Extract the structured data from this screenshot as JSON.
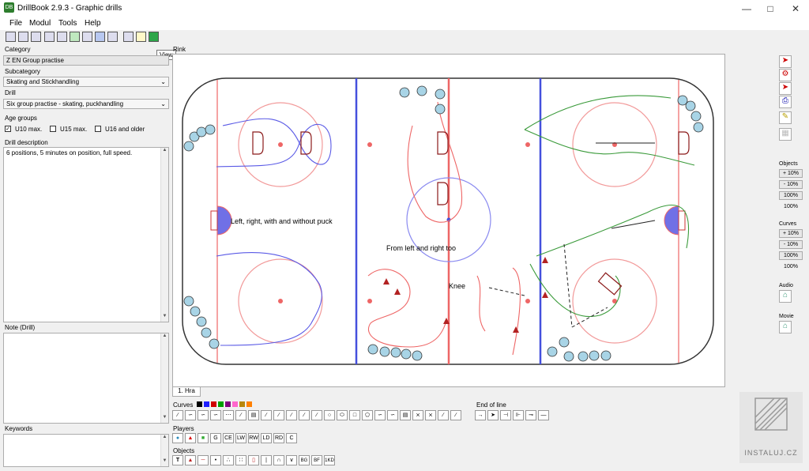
{
  "window": {
    "title": "DrillBook 2.9.3 - Graphic drills",
    "icon": "app-icon",
    "controls": [
      "minimize-icon",
      "maximize-icon",
      "close-icon"
    ]
  },
  "menu": [
    "File",
    "Modul",
    "Tools",
    "Help"
  ],
  "tooltip": "View",
  "left_panel": {
    "category_label": "Category",
    "category_value": "Z EN Group practise",
    "subcategory_label": "Subcategory",
    "subcategory_value": "Skating and Stickhandling",
    "drill_label": "Drill",
    "drill_value": "Six group practise - skating, puckhandling",
    "age_groups_label": "Age groups",
    "age_groups": [
      {
        "label": "U10 max.",
        "checked": true
      },
      {
        "label": "U15 max.",
        "checked": false
      },
      {
        "label": "U16 and older",
        "checked": false
      }
    ],
    "description_label": "Drill description",
    "description_value": "6 positions, 5 minutes on position, full speed.",
    "note_label": "Note (Drill)",
    "note_value": "",
    "keywords_label": "Keywords",
    "keywords_value": ""
  },
  "rink": {
    "label": "Rink",
    "texts": [
      "Left, right, with and without puck",
      "From left and right too",
      "Knee"
    ],
    "tab_label": "1. Hra"
  },
  "bottom": {
    "curves_label": "Curves",
    "end_of_line_label": "End of line",
    "players_label": "Players",
    "players": [
      "G",
      "CE",
      "LW",
      "RW",
      "LD",
      "RD",
      "C"
    ],
    "objects_label": "Objects",
    "objects": [
      "T",
      "BG",
      "BF",
      "1KD"
    ],
    "colors": [
      "#000000",
      "#1f1fff",
      "#d00000",
      "#00a000",
      "#800080",
      "#ff66cc",
      "#b8860b",
      "#ff8000"
    ]
  },
  "right_panel": {
    "objects_label": "Objects",
    "objects_buttons": [
      "+ 10%",
      "- 10%",
      "100%"
    ],
    "objects_value": "100%",
    "curves_label": "Curves",
    "curves_buttons": [
      "+ 10%",
      "- 10%",
      "100%"
    ],
    "curves_value": "100%",
    "audio_label": "Audio",
    "movie_label": "Movie"
  },
  "watermark": "INSTALUJ.CZ"
}
